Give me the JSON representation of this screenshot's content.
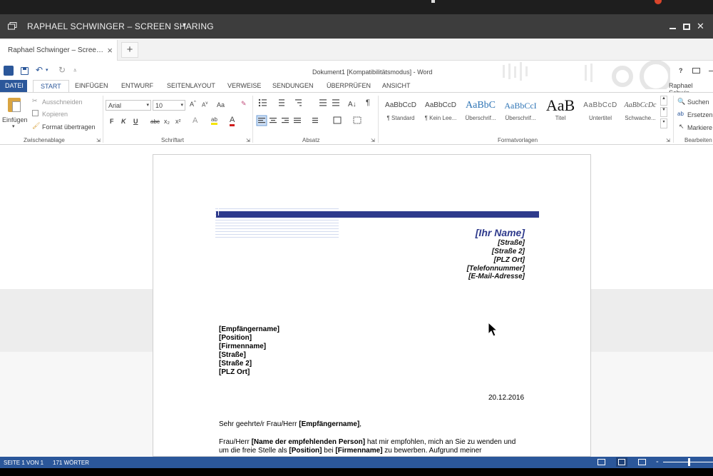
{
  "window": {
    "title": "RAPHAEL SCHWINGER – SCREEN SHARING",
    "dropdown": "▾",
    "min": "‗",
    "max": "□",
    "close": "✕"
  },
  "browser": {
    "tab_label": "Raphael Schwinger – Scree…",
    "tab_close": "×",
    "new_tab": "+"
  },
  "word": {
    "doc_title": "Dokument1 [Kompatibilitätsmodus] - Word",
    "help": "?",
    "user": "Raphael Schwin",
    "tabs": [
      "DATEI",
      "START",
      "EINFÜGEN",
      "ENTWURF",
      "SEITENLAYOUT",
      "VERWEISE",
      "SENDUNGEN",
      "ÜBERPRÜFEN",
      "ANSICHT"
    ],
    "clipboard": {
      "paste": "Einfügen",
      "cut": "Ausschneiden",
      "copy": "Kopieren",
      "format": "Format übertragen",
      "group": "Zwischenablage"
    },
    "font": {
      "name": "Arial",
      "size": "10",
      "group": "Schriftart",
      "aa": "Aa",
      "bold": "F",
      "italic": "K",
      "underline": "U",
      "strike": "abc",
      "sub": "x₂",
      "sup": "x²"
    },
    "paragraph": {
      "group": "Absatz",
      "pilcrow": "¶"
    },
    "styles": {
      "group": "Formatvorlagen",
      "items": [
        {
          "preview": "AaBbCcD",
          "name": "¶ Standard"
        },
        {
          "preview": "AaBbCcD",
          "name": "¶ Kein Lee..."
        },
        {
          "preview": "AaBbC",
          "name": "Überschrif..."
        },
        {
          "preview": "AaBbCcI",
          "name": "Überschrif..."
        },
        {
          "preview": "AaB",
          "name": "Titel"
        },
        {
          "preview": "AaBbCcD",
          "name": "Untertitel"
        },
        {
          "preview": "AaBbCcDc",
          "name": "Schwache..."
        }
      ]
    },
    "editing": {
      "find": "Suchen",
      "replace": "Ersetzen",
      "select": "Markiere",
      "group": "Bearbeiten"
    }
  },
  "document": {
    "name": "[Ihr Name]",
    "address": [
      "[Straße]",
      "[Straße 2]",
      "[PLZ Ort]",
      "[Telefonnummer]",
      "[E-Mail-Adresse]"
    ],
    "recipient": [
      "[Empfängername]",
      "[Position]",
      "[Firmenname]",
      "[Straße]",
      "[Straße 2]",
      "[PLZ Ort]"
    ],
    "date": "20.12.2016",
    "salutation_pre": "Sehr geehrte/r Frau/Herr ",
    "salutation_bold": "[Empfängername]",
    "salutation_post": ",",
    "body_1a": "Frau/Herr ",
    "body_1b": "[Name der empfehlenden Person]",
    "body_1c": " hat mir empfohlen, mich an Sie zu wenden und",
    "body_2a": "um die freie Stelle als ",
    "body_2b": "[Position]",
    "body_2c": " bei ",
    "body_2d": "[Firmenname]",
    "body_2e": " zu bewerben. Aufgrund meiner",
    "accent": "#2e3a8c"
  },
  "status": {
    "page": "SEITE 1 VON 1",
    "words": "171 WÖRTER",
    "color": "#2b579a"
  }
}
